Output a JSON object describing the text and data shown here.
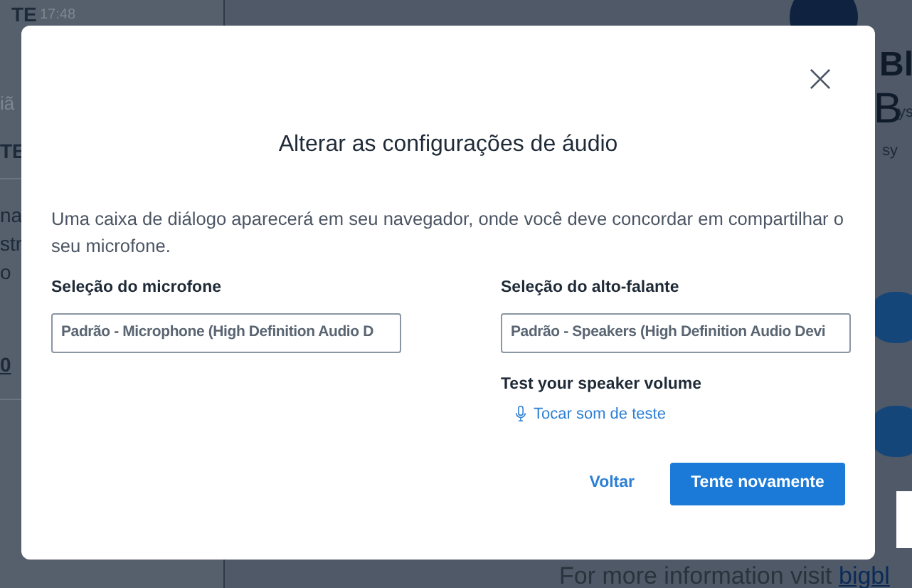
{
  "background": {
    "left_panel": [
      {
        "text": "TE",
        "kind": "name"
      },
      {
        "text": "17:48",
        "kind": "time"
      },
      {
        "text": "iã",
        "kind": "muted"
      },
      {
        "text": "TE",
        "kind": "name"
      },
      {
        "text": "na",
        "kind": "body"
      },
      {
        "text": "str",
        "kind": "body"
      },
      {
        "text": "o",
        "kind": "body"
      },
      {
        "text": "0",
        "kind": "link"
      }
    ],
    "right_panel": [
      {
        "text": "Bl",
        "kind": "heading"
      },
      {
        "text": "B",
        "kind": "big"
      },
      {
        "text": "ys",
        "kind": "small"
      },
      {
        "text": "sy",
        "kind": "small"
      }
    ],
    "footer": {
      "text": "For more information visit",
      "link": "bigbl"
    }
  },
  "dialog": {
    "title": "Alterar as configurações de áudio",
    "description": "Uma caixa de diálogo aparecerá em seu navegador, onde você deve concordar em compartilhar o seu microfone.",
    "microphone": {
      "label": "Seleção do microfone",
      "value": "Padrão - Microphone (High Definition Audio D"
    },
    "speaker": {
      "label": "Seleção do alto-falante",
      "value": "Padrão - Speakers (High Definition Audio Devi"
    },
    "speaker_test": {
      "label": "Test your speaker volume",
      "play": "Tocar som de teste"
    },
    "buttons": [
      {
        "label": "Voltar",
        "kind": "link"
      },
      {
        "label": "Tente novamente",
        "kind": "primary"
      }
    ]
  }
}
